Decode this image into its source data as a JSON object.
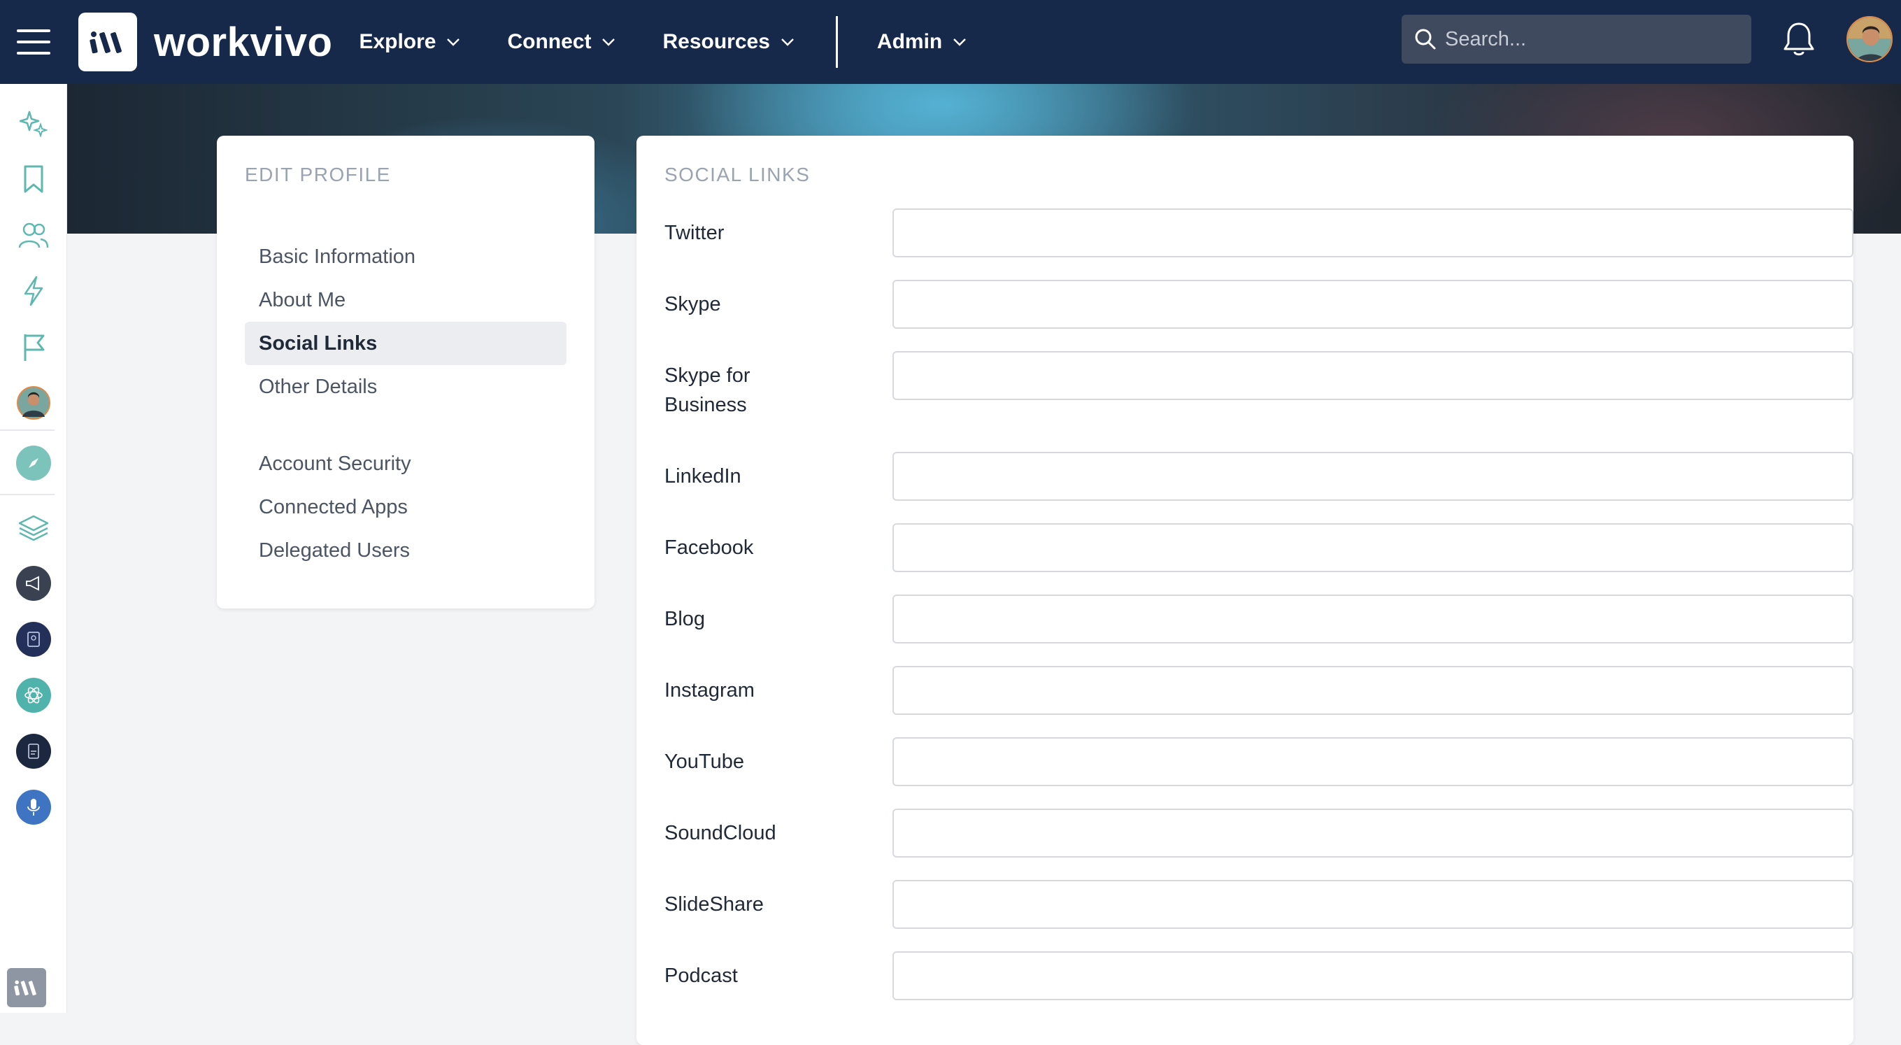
{
  "header": {
    "brand": "workvivo",
    "nav": [
      {
        "label": "Explore"
      },
      {
        "label": "Connect"
      },
      {
        "label": "Resources"
      },
      {
        "label": "Admin"
      }
    ],
    "search_placeholder": "Search..."
  },
  "sidebar_card": {
    "title": "EDIT PROFILE",
    "items_group1": [
      "Basic Information",
      "About Me",
      "Social Links",
      "Other Details"
    ],
    "items_group2": [
      "Account Security",
      "Connected Apps",
      "Delegated Users"
    ],
    "active_item": "Social Links"
  },
  "main_card": {
    "title": "SOCIAL LINKS",
    "fields": [
      {
        "label": "Twitter",
        "value": ""
      },
      {
        "label": "Skype",
        "value": ""
      },
      {
        "label": "Skype for Business",
        "value": ""
      },
      {
        "label": "LinkedIn",
        "value": ""
      },
      {
        "label": "Facebook",
        "value": ""
      },
      {
        "label": "Blog",
        "value": ""
      },
      {
        "label": "Instagram",
        "value": ""
      },
      {
        "label": "YouTube",
        "value": ""
      },
      {
        "label": "SoundCloud",
        "value": ""
      },
      {
        "label": "SlideShare",
        "value": ""
      },
      {
        "label": "Podcast",
        "value": ""
      }
    ]
  },
  "rail_icons": [
    "sparkle-icon",
    "bookmark-icon",
    "people-icon",
    "lightning-icon",
    "flag-icon",
    "user-avatar",
    "compass-icon",
    "layers-icon",
    "megaphone-space-icon",
    "notebook-space-icon",
    "atom-space-icon",
    "document-space-icon",
    "microphone-space-icon"
  ],
  "colors": {
    "topbar": "#17294a",
    "rail_icon": "#5fb8b0",
    "active_menu_bg": "#ebedf0"
  }
}
